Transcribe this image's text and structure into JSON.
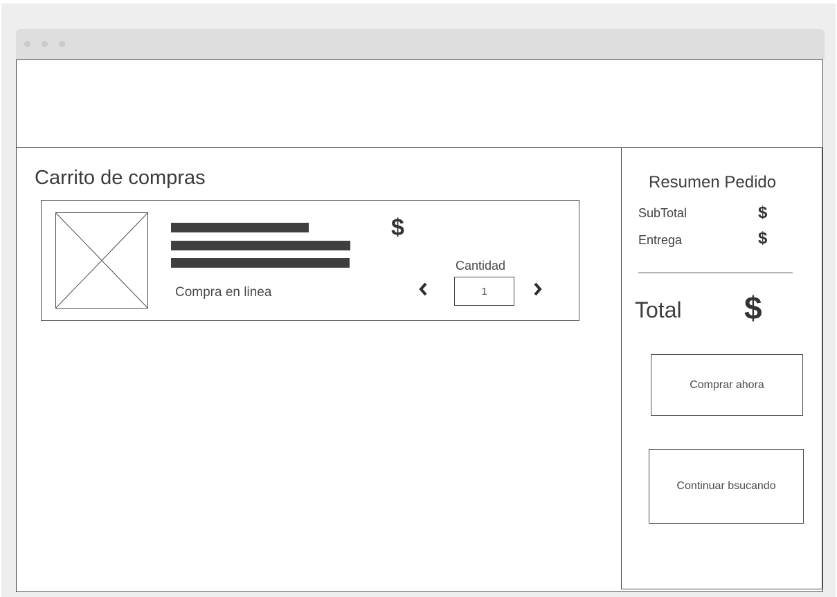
{
  "window": {
    "dots": [
      "",
      "",
      ""
    ]
  },
  "cart": {
    "title": "Carrito de compras",
    "item": {
      "price_symbol": "$",
      "note": "Compra en linea",
      "quantity_label": "Cantidad",
      "quantity_value": "1",
      "prev_symbol": "‹",
      "next_symbol": "›"
    }
  },
  "summary": {
    "title": "Resumen Pedido",
    "subtotal_label": "SubTotal",
    "subtotal_value": "$",
    "delivery_label": "Entrega",
    "delivery_value": "$",
    "total_label": "Total",
    "total_value": "$",
    "buy_now_label": "Comprar ahora",
    "continue_label": "Continuar bsucando"
  },
  "icons": {
    "image_placeholder": "image-placeholder-icon",
    "prev": "chevron-left-icon",
    "next": "chevron-right-icon"
  },
  "colors": {
    "background": "#eeeeee",
    "titlebar": "#dedede",
    "border": "#4a4a4a",
    "text": "#3b3b3b"
  }
}
